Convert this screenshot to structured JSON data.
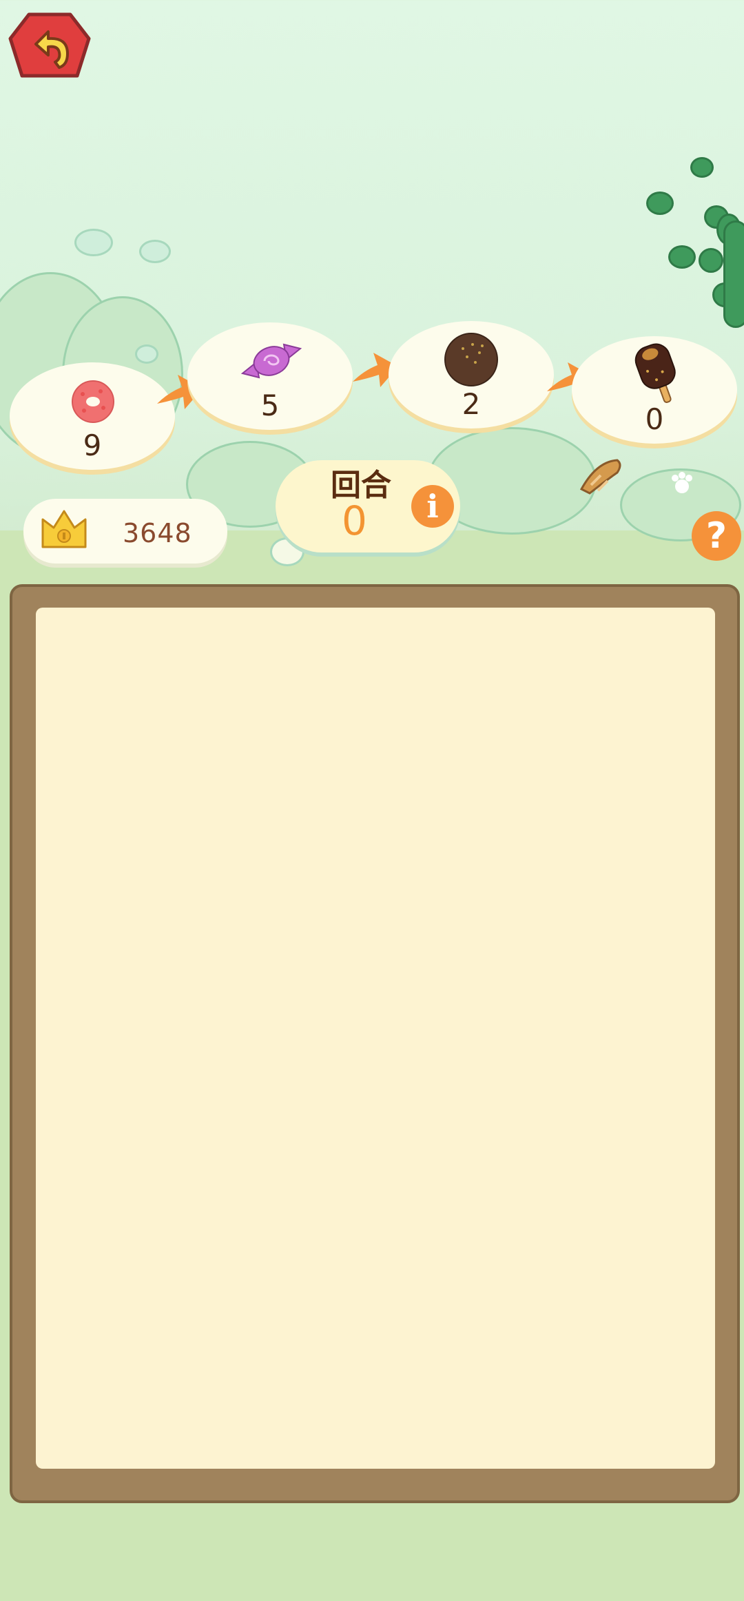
{
  "game": {
    "progression": [
      {
        "item": "donut-icon",
        "count": "9"
      },
      {
        "item": "candy-icon",
        "count": "5"
      },
      {
        "item": "chocolate-ball-icon",
        "count": "2"
      },
      {
        "item": "ice-cream-bar-icon",
        "count": "0"
      }
    ],
    "score": "3648",
    "round_label": "回合",
    "round_value": "0",
    "info_glyph": "i",
    "help_glyph": "?"
  },
  "colors": {
    "accent": "#f5923a",
    "back_button": "#e03e3e",
    "board_frame": "#a0835c",
    "board_surface": "#fdf3d1"
  }
}
